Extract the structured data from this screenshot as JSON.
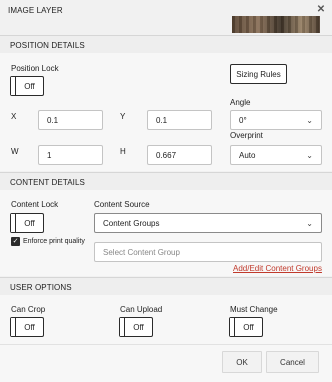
{
  "dialog": {
    "title": "IMAGE LAYER",
    "close_icon": "close-icon"
  },
  "position": {
    "heading": "POSITION DETAILS",
    "lock_label": "Position Lock",
    "lock_value": "Off",
    "sizing_rules_label": "Sizing Rules",
    "x_label": "X",
    "x_value": "0.1",
    "y_label": "Y",
    "y_value": "0.1",
    "w_label": "W",
    "w_value": "1",
    "h_label": "H",
    "h_value": "0.667",
    "angle_label": "Angle",
    "angle_value": "0°",
    "overprint_label": "Overprint",
    "overprint_value": "Auto"
  },
  "content": {
    "heading": "CONTENT DETAILS",
    "lock_label": "Content Lock",
    "lock_value": "Off",
    "enforce_label": "Enforce print quality",
    "source_label": "Content Source",
    "source_value": "Content Groups",
    "group_placeholder": "Select Content Group",
    "edit_link": "Add/Edit Content Groups"
  },
  "user": {
    "heading": "USER OPTIONS",
    "can_crop_label": "Can Crop",
    "can_crop_value": "Off",
    "can_upload_label": "Can Upload",
    "can_upload_value": "Off",
    "must_change_label": "Must Change",
    "must_change_value": "Off"
  },
  "footer": {
    "ok_label": "OK",
    "cancel_label": "Cancel"
  }
}
